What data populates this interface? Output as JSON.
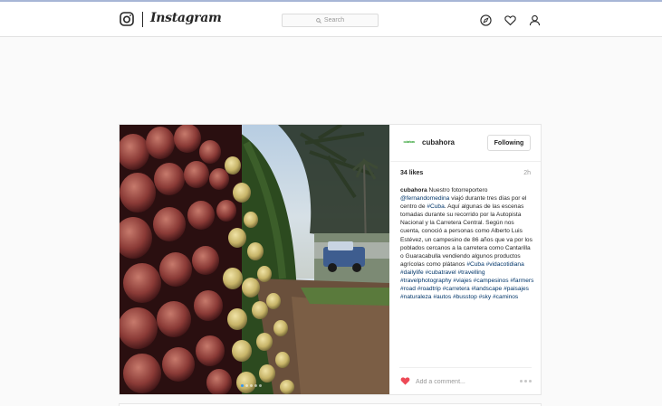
{
  "nav": {
    "brand": "Instagram",
    "search_placeholder": "Search",
    "icons": [
      "camera-logo-icon",
      "search-icon",
      "compass-icon",
      "heart-icon",
      "user-icon"
    ]
  },
  "post": {
    "avatar_text": "cubahora",
    "username": "cubahora",
    "follow_label": "Following",
    "likes": "34 likes",
    "time": "2h",
    "caption": {
      "author": "cubahora",
      "segments": [
        {
          "t": " Nuestro fotorreportero ",
          "tag": false
        },
        {
          "t": "@fernandomedina",
          "tag": true
        },
        {
          "t": " viajó durante tres días por el centro de ",
          "tag": false
        },
        {
          "t": "#Cuba",
          "tag": true
        },
        {
          "t": ". Aquí algunas de las escenas tomadas durante su recorrido por la Autopista Nacional y la Carretera Central. Según nos cuenta, conoció a personas como Alberto Luis Estévez, un campesino de 86 años que va por los poblados cercanos a la carretera como Cantarilla o Guaracabulla vendiendo algunos productos agrícolas como plátanos ",
          "tag": false
        },
        {
          "t": "#Cuba",
          "tag": true
        },
        {
          "t": " ",
          "tag": false
        },
        {
          "t": "#vidacotidiana",
          "tag": true
        },
        {
          "t": " ",
          "tag": false
        },
        {
          "t": "#dailylife",
          "tag": true
        },
        {
          "t": " ",
          "tag": false
        },
        {
          "t": "#cubatravel",
          "tag": true
        },
        {
          "t": " ",
          "tag": false
        },
        {
          "t": "#travelling",
          "tag": true
        },
        {
          "t": " ",
          "tag": false
        },
        {
          "t": "#travelphotography",
          "tag": true
        },
        {
          "t": " ",
          "tag": false
        },
        {
          "t": "#viajes",
          "tag": true
        },
        {
          "t": " ",
          "tag": false
        },
        {
          "t": "#campesinos",
          "tag": true
        },
        {
          "t": " ",
          "tag": false
        },
        {
          "t": "#farmers",
          "tag": true
        },
        {
          "t": " ",
          "tag": false
        },
        {
          "t": "#road",
          "tag": true
        },
        {
          "t": " ",
          "tag": false
        },
        {
          "t": "#roadtrip",
          "tag": true
        },
        {
          "t": " ",
          "tag": false
        },
        {
          "t": "#carretera",
          "tag": true
        },
        {
          "t": " ",
          "tag": false
        },
        {
          "t": "#landscape",
          "tag": true
        },
        {
          "t": " ",
          "tag": false
        },
        {
          "t": "#paisajes",
          "tag": true
        },
        {
          "t": " ",
          "tag": false
        },
        {
          "t": "#naturaleza",
          "tag": true
        },
        {
          "t": " ",
          "tag": false
        },
        {
          "t": "#autos",
          "tag": true
        },
        {
          "t": " ",
          "tag": false
        },
        {
          "t": "#busstop",
          "tag": true
        },
        {
          "t": " ",
          "tag": false
        },
        {
          "t": "#sky",
          "tag": true
        },
        {
          "t": " ",
          "tag": false
        },
        {
          "t": "#caminos",
          "tag": true
        }
      ]
    },
    "comment_placeholder": "Add a comment...",
    "carousel": {
      "count": 5,
      "active": 0
    }
  },
  "colors": {
    "like": "#ed4956",
    "hashtag": "#003569",
    "carousel_active": "#3897f0"
  }
}
